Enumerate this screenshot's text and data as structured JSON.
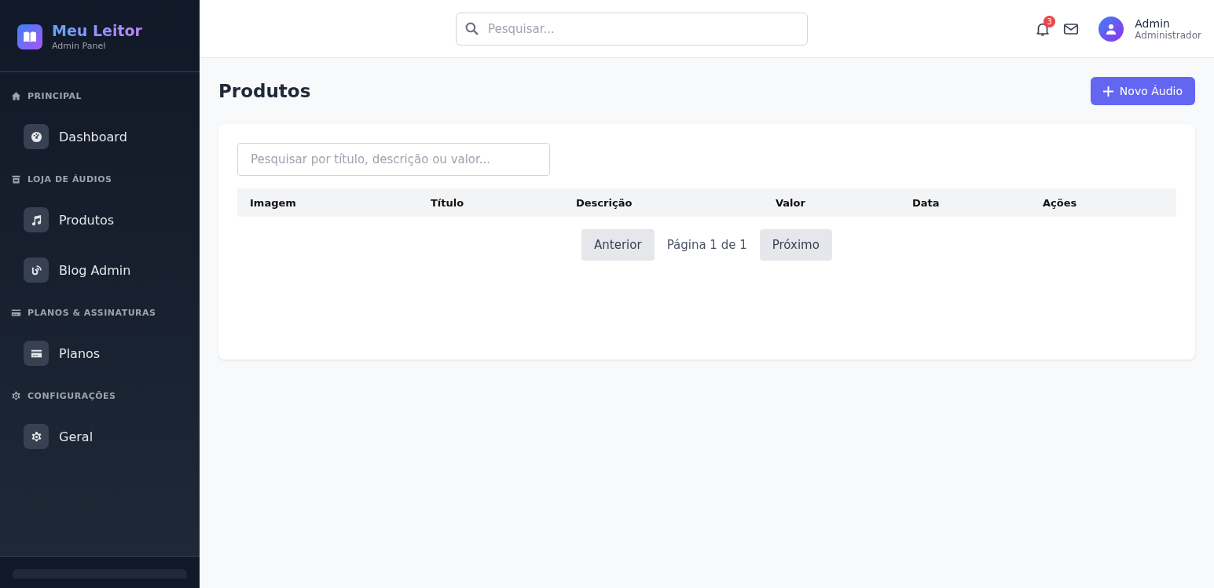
{
  "brand": {
    "title": "Meu Leitor",
    "subtitle": "Admin Panel"
  },
  "sidebar": {
    "sections": [
      {
        "title": "PRINCIPAL",
        "items": [
          {
            "label": "Dashboard"
          }
        ]
      },
      {
        "title": "LOJA DE ÁUDIOS",
        "items": [
          {
            "label": "Produtos"
          },
          {
            "label": "Blog Admin"
          }
        ]
      },
      {
        "title": "PLANOS & ASSINATURAS",
        "items": [
          {
            "label": "Planos"
          }
        ]
      },
      {
        "title": "CONFIGURAÇÕES",
        "items": [
          {
            "label": "Geral"
          }
        ]
      }
    ]
  },
  "topbar": {
    "search": {
      "placeholder": "Pesquisar..."
    },
    "notification_count": "3",
    "user": {
      "name": "Admin",
      "role": "Administrador"
    }
  },
  "page": {
    "title": "Produtos",
    "new_button": "Novo Áudio"
  },
  "filter": {
    "placeholder": "Pesquisar por título, descrição ou valor..."
  },
  "table": {
    "columns": [
      "Imagem",
      "Título",
      "Descrição",
      "Valor",
      "Data",
      "Ações"
    ]
  },
  "pagination": {
    "previous": "Anterior",
    "info": "Página 1 de 1",
    "next": "Próximo"
  }
}
